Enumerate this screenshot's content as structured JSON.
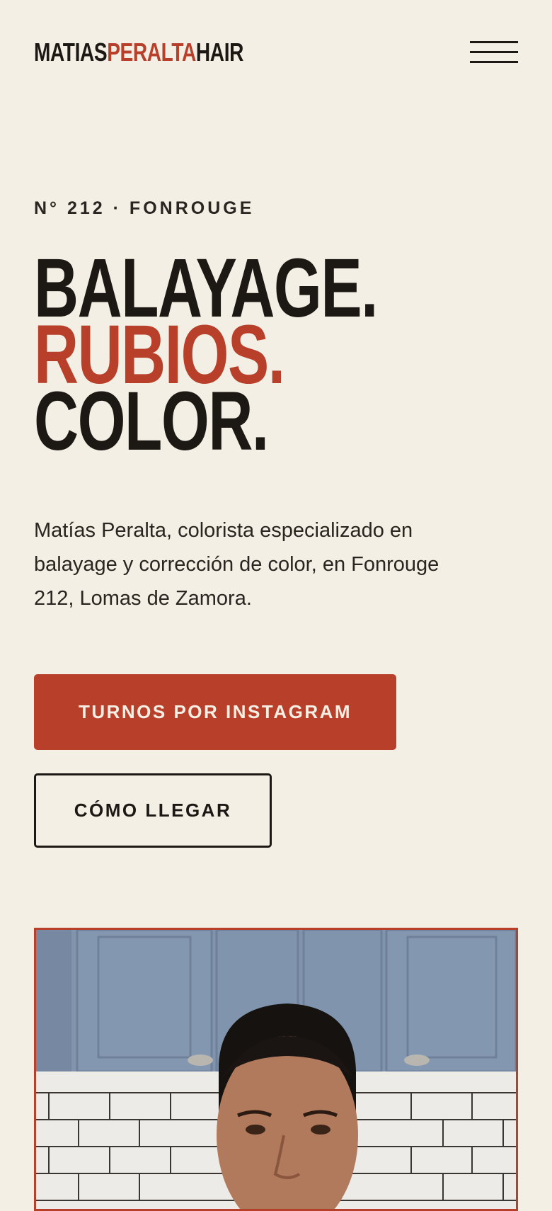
{
  "header": {
    "logo_part1": "MATIAS",
    "logo_part2": "PERALTA",
    "logo_part3": "HAIR",
    "menu_icon": "hamburger-menu-icon"
  },
  "hero": {
    "eyebrow": "N° 212 · FONROUGE",
    "headline_line1": "BALAYAGE.",
    "headline_line2": "RUBIOS.",
    "headline_line3": "COLOR.",
    "lead": "Matías Peralta, colorista especializado en balayage y corrección de color, en Fonrouge 212, Lomas de Zamora.",
    "primary_cta": "TURNOS POR INSTAGRAM",
    "secondary_cta": "CÓMO LLEGAR"
  },
  "photo": {
    "subject": "portrait-photo"
  },
  "colors": {
    "background": "#f3efe5",
    "accent": "#b8402b",
    "ink": "#1c1814"
  }
}
